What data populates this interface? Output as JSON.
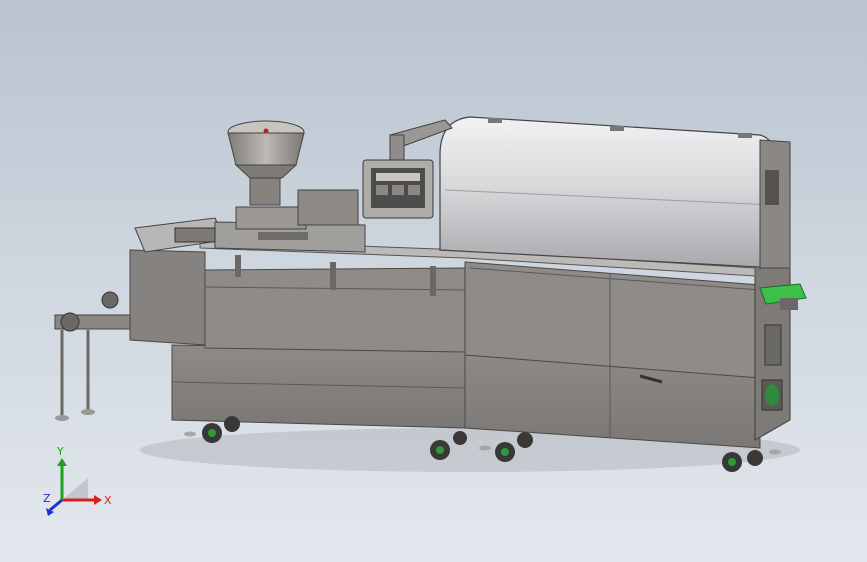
{
  "viewport": {
    "background_top": "#b9c3cf",
    "background_bottom": "#e4e8ee"
  },
  "triad": {
    "x_label": "X",
    "y_label": "Y",
    "z_label": "Z",
    "x_color": "#d62020",
    "y_color": "#1fa01f",
    "z_color": "#2030d0"
  },
  "model": {
    "body_color": "#8a8784",
    "cover_color": "#d8d8da",
    "wheel_accent_color": "#2e9a3a",
    "conveyor_color": "#3cc04a"
  }
}
